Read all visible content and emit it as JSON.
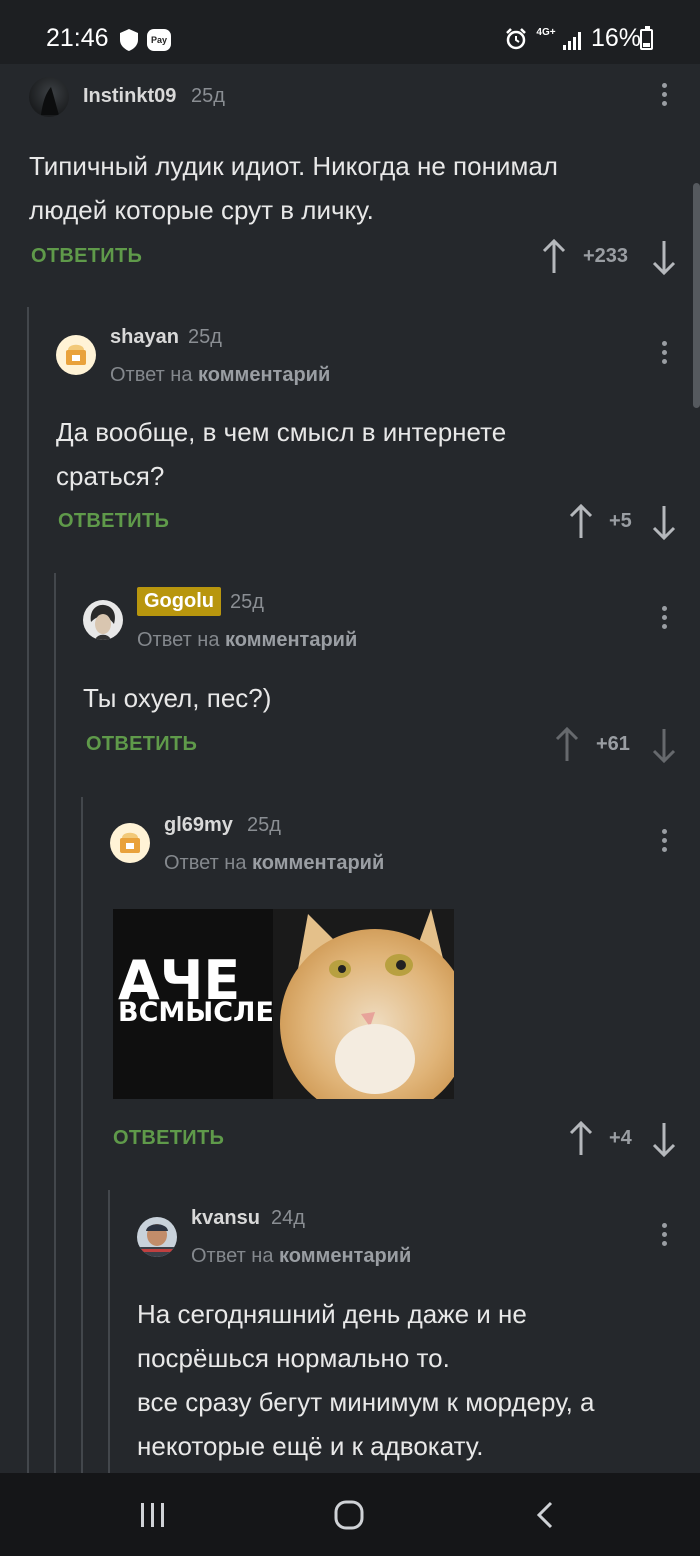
{
  "status_bar": {
    "time": "21:46",
    "pay": "Pay",
    "network": "4G+",
    "battery": "16%"
  },
  "comments": [
    {
      "username": "Instinkt09",
      "date": "25д",
      "text_lines": [
        "Типичный лудик идиот. Никогда не понимал",
        "людей которые срут в личку."
      ],
      "reply_label": "ОТВЕТИТЬ",
      "votes": "+233"
    },
    {
      "username": "shayan",
      "date": "25д",
      "reply_prefix": "Ответ на",
      "reply_target": "комментарий",
      "text_lines": [
        "Да вообще, в чем смысл в интернете",
        "сраться?"
      ],
      "reply_label": "ОТВЕТИТЬ",
      "votes": "+5"
    },
    {
      "username": "Gogolu",
      "date": "25д",
      "reply_prefix": "Ответ на",
      "reply_target": "комментарий",
      "text_lines": [
        "Ты охуел, пес?)"
      ],
      "reply_label": "ОТВЕТИТЬ",
      "votes": "+61"
    },
    {
      "username": "gl69my",
      "date": "25д",
      "reply_prefix": "Ответ на",
      "reply_target": "комментарий",
      "image_text_1": "АЧЕ",
      "image_text_2": "ВСМЫСЛЕ",
      "reply_label": "ОТВЕТИТЬ",
      "votes": "+4"
    },
    {
      "username": "kvansu",
      "date": "24д",
      "reply_prefix": "Ответ на",
      "reply_target": "комментарий",
      "text_lines": [
        "На сегодняшний день даже и не",
        "посрёшься нормально то.",
        "все сразу бегут минимум к мордеру, а",
        "некоторые ещё и к адвокату."
      ]
    }
  ]
}
